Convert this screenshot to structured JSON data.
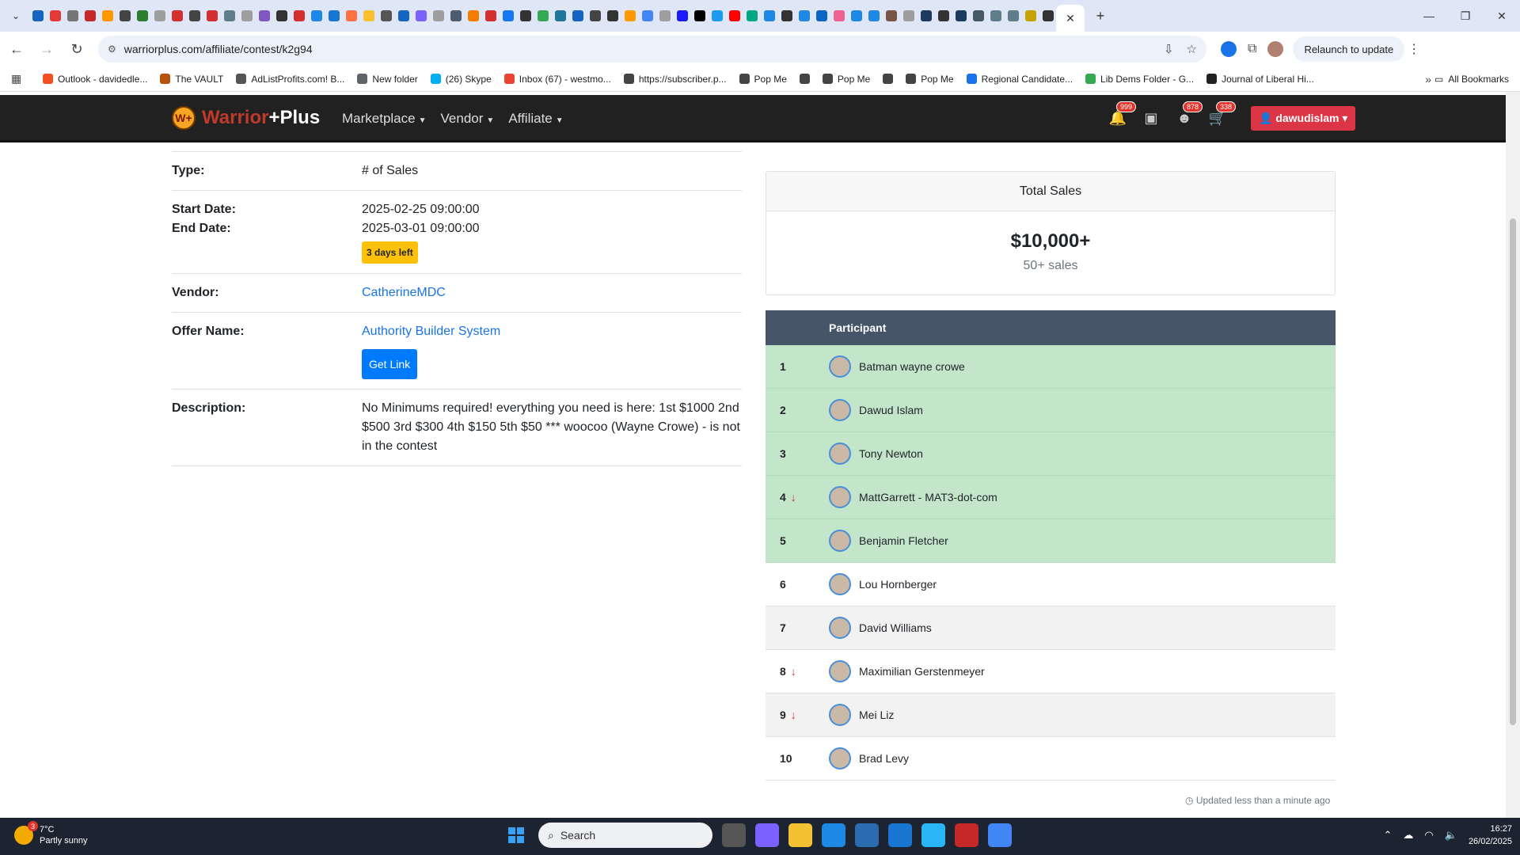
{
  "browser": {
    "tab_close_glyph": "✕",
    "new_tab_glyph": "+",
    "url": "warriorplus.com/affiliate/contest/k2g94",
    "relaunch_label": "Relaunch to update",
    "pinned_tab_colors": [
      "#1565c0",
      "#e53935",
      "#757575",
      "#c62828",
      "#ff9800",
      "#444",
      "#2e7d32",
      "#9e9e9e",
      "#d32f2f",
      "#444",
      "#d32f2f",
      "#607d8b",
      "#9e9e9e",
      "#7e57c2",
      "#333",
      "#d32f2f",
      "#1e88e5",
      "#1976d2",
      "#ff7043",
      "#fbc02d",
      "#555",
      "#1565c0",
      "#7b61ff",
      "#9e9e9e",
      "#4e5b6e",
      "#f57c00",
      "#d32f2f",
      "#1877f2",
      "#333",
      "#34a853",
      "#21759b",
      "#1565c0",
      "#444",
      "#333",
      "#ff9900",
      "#4285f4",
      "#9e9e9e",
      "#1a1aff",
      "#000",
      "#1d9bf0",
      "#ff0000",
      "#00a884",
      "#1e88e5",
      "#333",
      "#1e88e5",
      "#0a66c2",
      "#f06292",
      "#1e88e5",
      "#1e88e5",
      "#795548",
      "#9e9e9e",
      "#1e3a5f",
      "#333",
      "#1e3a5f",
      "#455a64",
      "#607d8b",
      "#607d8b",
      "#c8a200",
      "#333"
    ],
    "bookmarks": [
      {
        "label": "Outlook - davidedle...",
        "color": "#f25022"
      },
      {
        "label": "The VAULT",
        "color": "#b45309"
      },
      {
        "label": "AdListProfits.com! B...",
        "color": "#555"
      },
      {
        "label": "New folder",
        "color": "#5f6368"
      },
      {
        "label": "(26) Skype",
        "color": "#00aff0"
      },
      {
        "label": "Inbox (67) - westmo...",
        "color": "#ea4335"
      },
      {
        "label": "https://subscriber.p...",
        "color": "#444"
      },
      {
        "label": "Pop Me",
        "color": "#444"
      },
      {
        "label": "",
        "color": "#444"
      },
      {
        "label": "Pop Me",
        "color": "#444"
      },
      {
        "label": "",
        "color": "#444"
      },
      {
        "label": "Pop Me",
        "color": "#444"
      },
      {
        "label": "Regional Candidate...",
        "color": "#1a73e8"
      },
      {
        "label": "Lib Dems Folder - G...",
        "color": "#34a853"
      },
      {
        "label": "Journal of Liberal Hi...",
        "color": "#222"
      }
    ],
    "all_bookmarks_label": "All Bookmarks"
  },
  "site": {
    "brand_name": "Warrior",
    "brand_plus": "+Plus",
    "brand_logo_text": "W+",
    "menu": [
      "Marketplace",
      "Vendor",
      "Affiliate"
    ],
    "notification_count": "999",
    "friends_count": "878",
    "cart_count": "338",
    "username": "dawudislam"
  },
  "contest": {
    "type_label": "Type:",
    "type_value": "# of Sales",
    "start_label": "Start Date:",
    "start_value": "2025-02-25 09:00:00",
    "end_label": "End Date:",
    "end_value": "2025-03-01 09:00:00",
    "time_left": "3 days left",
    "vendor_label": "Vendor:",
    "vendor_value": "CatherineMDC",
    "offer_label": "Offer Name:",
    "offer_value": "Authority Builder System",
    "get_link_label": "Get Link",
    "description_label": "Description:",
    "description_value": "No Minimums required! everything you need is here: 1st $1000 2nd $500 3rd $300 4th $150 5th $50 *** woocoo (Wayne Crowe) - is not in the contest"
  },
  "total_sales": {
    "header": "Total Sales",
    "amount": "$10,000+",
    "sales": "50+ sales"
  },
  "leaderboard": {
    "header": "Participant",
    "rows": [
      {
        "rank": "1",
        "name": "Batman wayne crowe",
        "trend": ""
      },
      {
        "rank": "2",
        "name": "Dawud Islam",
        "trend": ""
      },
      {
        "rank": "3",
        "name": "Tony Newton",
        "trend": ""
      },
      {
        "rank": "4",
        "name": "MattGarrett - MAT3-dot-com",
        "trend": "down"
      },
      {
        "rank": "5",
        "name": "Benjamin Fletcher",
        "trend": ""
      },
      {
        "rank": "6",
        "name": "Lou Hornberger",
        "trend": ""
      },
      {
        "rank": "7",
        "name": "David Williams",
        "trend": ""
      },
      {
        "rank": "8",
        "name": "Maximilian Gerstenmeyer",
        "trend": "down"
      },
      {
        "rank": "9",
        "name": "Mei Liz",
        "trend": "down"
      },
      {
        "rank": "10",
        "name": "Brad Levy",
        "trend": ""
      }
    ],
    "winners_count": 5,
    "updated_text": "Updated less than a minute ago"
  },
  "taskbar": {
    "weather_badge": "3",
    "temperature": "7°C",
    "weather_desc": "Partly sunny",
    "search_placeholder": "Search",
    "time": "16:27",
    "date": "26/02/2025"
  }
}
